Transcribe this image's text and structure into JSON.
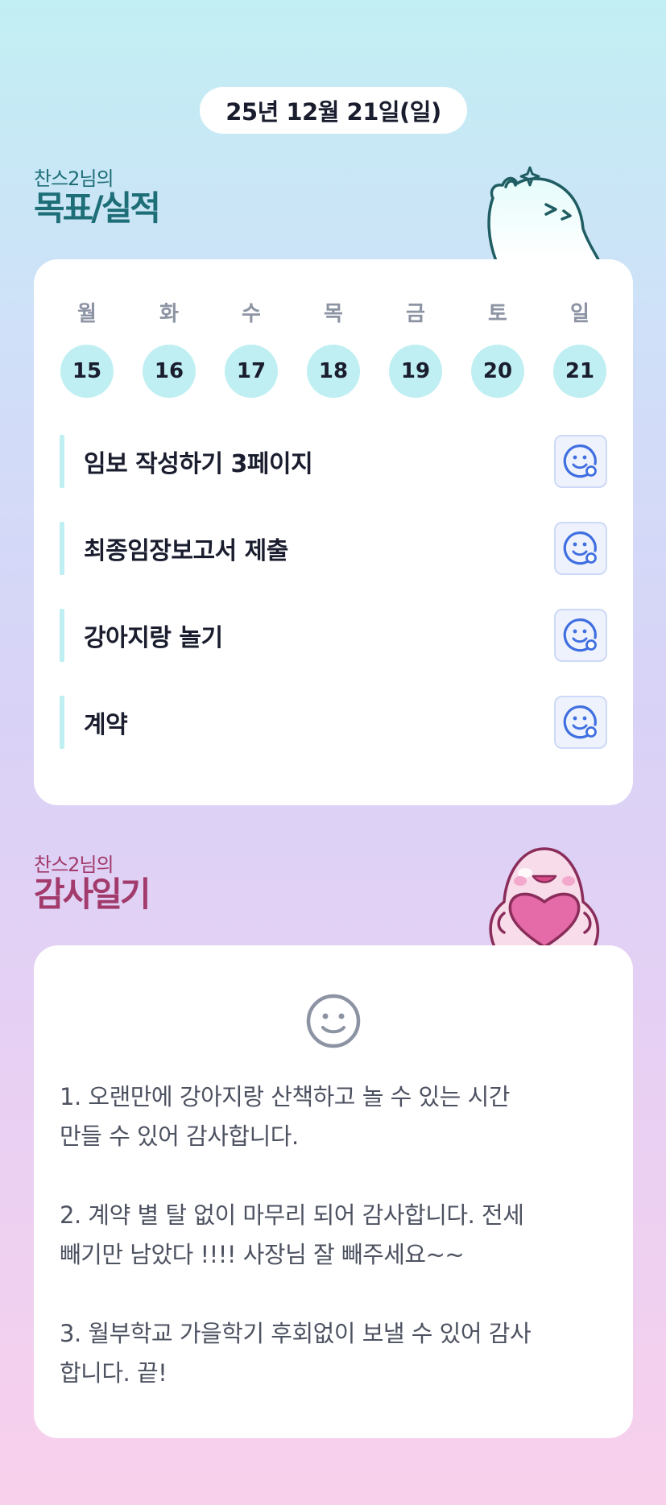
{
  "header": {
    "date": "25년 12월 21일(일)"
  },
  "goals_section": {
    "owner": "찬스2님의",
    "title": "목표/실적",
    "week": [
      {
        "day": "월",
        "date": "15"
      },
      {
        "day": "화",
        "date": "16"
      },
      {
        "day": "수",
        "date": "17"
      },
      {
        "day": "목",
        "date": "18"
      },
      {
        "day": "금",
        "date": "19"
      },
      {
        "day": "토",
        "date": "20"
      },
      {
        "day": "일",
        "date": "21"
      }
    ],
    "goals": [
      {
        "text": "임보 작성하기 3페이지",
        "icon": "face-add-icon"
      },
      {
        "text": "최종임장보고서 제출",
        "icon": "face-add-icon"
      },
      {
        "text": "강아지랑 놀기",
        "icon": "face-add-icon"
      },
      {
        "text": "계약",
        "icon": "face-add-icon"
      }
    ]
  },
  "thanks_section": {
    "owner": "찬스2님의",
    "title": "감사일기",
    "icon": "smile-icon",
    "body": "1. 오랜만에 강아지랑 산책하고 놀 수 있는 시간\n만들 수 있어 감사합니다.\n\n2. 계약 별 탈 없이 마무리 되어 감사합니다. 전세\n빼기만 남았다 !!!! 사장님 잘 빼주세요~~\n\n3. 월부학교 가을학기 후회없이 보낼 수 있어 감사\n합니다. 끝!"
  },
  "colors": {
    "accent_teal": "#bfeff2",
    "goal_title": "#1e6e78",
    "thanks_title": "#a23a6b",
    "icon_blue": "#3f6fe0"
  }
}
